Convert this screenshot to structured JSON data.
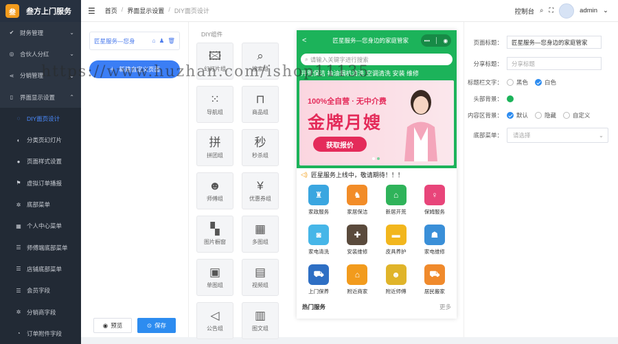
{
  "app": {
    "title": "叁方上门服务",
    "logo_text": "叁"
  },
  "sidebar": {
    "items": [
      {
        "label": "财务管理",
        "icon": "✔",
        "chev": "⌄",
        "sub": false,
        "active": false
      },
      {
        "label": "合伙人分红",
        "icon": "◎",
        "chev": "⌄",
        "sub": false,
        "active": false
      },
      {
        "label": "分销管理",
        "icon": "⋖",
        "chev": "⌄",
        "sub": false,
        "active": false
      },
      {
        "label": "界面显示设置",
        "icon": "▯",
        "chev": "⌃",
        "sub": false,
        "active": false
      },
      {
        "label": "DIY面页设计",
        "icon": "◌",
        "chev": "",
        "sub": true,
        "active": true
      },
      {
        "label": "分类页幻灯片",
        "icon": "◐",
        "chev": "",
        "sub": true,
        "active": false
      },
      {
        "label": "页面样式设置",
        "icon": "●",
        "chev": "",
        "sub": true,
        "active": false
      },
      {
        "label": "虚拟订单播报",
        "icon": "⚑",
        "chev": "",
        "sub": true,
        "active": false
      },
      {
        "label": "底部菜单",
        "icon": "✲",
        "chev": "",
        "sub": true,
        "active": false
      },
      {
        "label": "个人中心菜单",
        "icon": "▦",
        "chev": "",
        "sub": true,
        "active": false
      },
      {
        "label": "师傅端底部菜单",
        "icon": "☰",
        "chev": "",
        "sub": true,
        "active": false
      },
      {
        "label": "店铺底部菜单",
        "icon": "☰",
        "chev": "",
        "sub": true,
        "active": false
      },
      {
        "label": "会员字段",
        "icon": "☰",
        "chev": "",
        "sub": true,
        "active": false
      },
      {
        "label": "分销商字段",
        "icon": "✲",
        "chev": "",
        "sub": true,
        "active": false
      },
      {
        "label": "订单附件字段",
        "icon": "◔",
        "chev": "",
        "sub": true,
        "active": false
      }
    ]
  },
  "topbar": {
    "breadcrumb": [
      "首页",
      "界面显示设置",
      "DIY面页设计"
    ],
    "breadcrumb_sep": "/",
    "console": "控制台",
    "user": "admin"
  },
  "pages": {
    "item_label": "匠星服务—您身",
    "new_button": "新建自定义页面",
    "preview": "预览",
    "save": "保存"
  },
  "components": {
    "heading": "DIY组件",
    "items": [
      {
        "label": "幻灯片组",
        "icon": "🖾"
      },
      {
        "label": "搜索组",
        "icon": "⌕"
      },
      {
        "label": "导航组",
        "icon": "⁙"
      },
      {
        "label": "商品组",
        "icon": "⊓"
      },
      {
        "label": "拼团组",
        "icon": "拼"
      },
      {
        "label": "秒杀组",
        "icon": "秒"
      },
      {
        "label": "师傅组",
        "icon": "☻"
      },
      {
        "label": "优惠券组",
        "icon": "¥"
      },
      {
        "label": "图片橱窗",
        "icon": "▚"
      },
      {
        "label": "多图组",
        "icon": "▦"
      },
      {
        "label": "单图组",
        "icon": "▣"
      },
      {
        "label": "视频组",
        "icon": "▤"
      },
      {
        "label": "公告组",
        "icon": "◁"
      },
      {
        "label": "图文组",
        "icon": "▥"
      }
    ]
  },
  "preview": {
    "header_title": "匠星服务—您身边的家庭管家",
    "back": "<",
    "capsule_more": "•••",
    "capsule_close": "◉",
    "search_placeholder": "请输入关键字进行搜索",
    "hotwords": "开荒保洁 抽油烟机清洗 空调清洗 安装 维修",
    "banner": {
      "line1": "100%全自营 · 无中介费",
      "line2": "金牌月嫂",
      "button": "获取报价"
    },
    "notice": "匠星服务上线中，敬请期待！！！",
    "notice_icon": "◁)",
    "nav": [
      {
        "label": "家政服务",
        "color": "#3aa6e0",
        "icon": "♜"
      },
      {
        "label": "家居保洁",
        "color": "#f28c28",
        "icon": "♞"
      },
      {
        "label": "新居开荒",
        "color": "#2fb35a",
        "icon": "⌂"
      },
      {
        "label": "保姆服务",
        "color": "#e8457a",
        "icon": "♀"
      },
      {
        "label": "家电清洗",
        "color": "#46b6e8",
        "icon": "◙"
      },
      {
        "label": "安装维修",
        "color": "#5a4a3c",
        "icon": "✚"
      },
      {
        "label": "皮具养护",
        "color": "#f2b61d",
        "icon": "▬"
      },
      {
        "label": "家电维修",
        "color": "#3a8fd8",
        "icon": "☗"
      },
      {
        "label": "上门保养",
        "color": "#2e6fc4",
        "icon": "⛟"
      },
      {
        "label": "附近商家",
        "color": "#f29b1d",
        "icon": "⌂"
      },
      {
        "label": "附近师傅",
        "color": "#e0b42a",
        "icon": "☻"
      },
      {
        "label": "居民搬家",
        "color": "#f08a2c",
        "icon": "⛟"
      }
    ],
    "hot_title": "热门服务",
    "hot_more": "更多"
  },
  "form": {
    "page_title_label": "页面标题：",
    "page_title_value": "匠星服务—您身边的家庭管家",
    "share_title_label": "分享标题：",
    "share_title_placeholder": "分享标题",
    "text_color_label": "标题栏文字：",
    "text_color_options": [
      "黑色",
      "白色"
    ],
    "header_bg_label": "头部背景：",
    "content_bg_label": "内容区背景：",
    "content_bg_options": [
      "默认",
      "隐藏",
      "自定义"
    ],
    "bottom_menu_label": "底部菜单：",
    "bottom_menu_placeholder": "请选择"
  },
  "colors": {
    "accent": "#2d8cf0",
    "brand_green": "#1cb35a",
    "sidebar": "#2c3542"
  },
  "watermark": "https://www.huzhan.com/ishop11135"
}
